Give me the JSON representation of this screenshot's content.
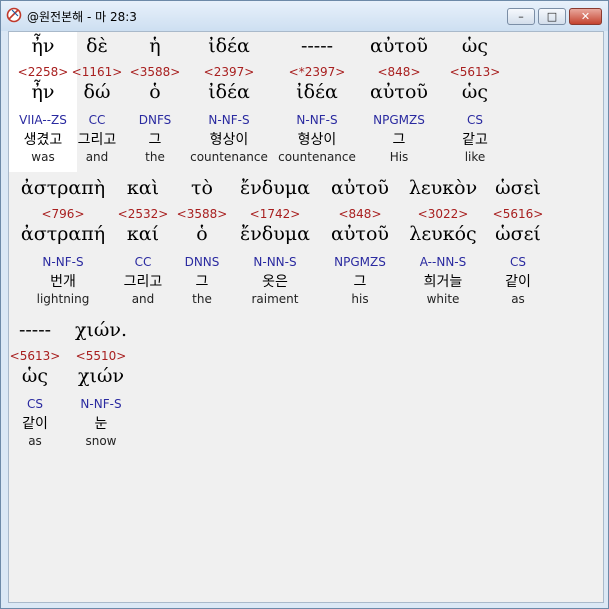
{
  "window": {
    "title": "@원전본해 - 마 28:3",
    "controls": {
      "minimize_icon": "minimize-icon",
      "maximize_icon": "maximize-icon",
      "close_icon": "close-icon"
    }
  },
  "rows": [
    [
      {
        "greek": "ἦν",
        "strong": "<2258>",
        "lemma": "ἦν",
        "parse": "VIIA--ZS",
        "korean": "생겼고",
        "english": "was"
      },
      {
        "greek": "δὲ",
        "strong": "<1161>",
        "lemma": "δώ",
        "parse": "CC",
        "korean": "그리고",
        "english": "and"
      },
      {
        "greek": "ἡ",
        "strong": "<3588>",
        "lemma": "ὁ",
        "parse": "DNFS",
        "korean": "그",
        "english": "the"
      },
      {
        "greek": "ἰδέα",
        "strong": "<2397>",
        "lemma": "ἰδέα",
        "parse": "N-NF-S",
        "korean": "형상이",
        "english": "countenance"
      },
      {
        "greek": "-----",
        "strong": "<*2397>",
        "lemma": "ἰδέα",
        "parse": "N-NF-S",
        "korean": "형상이",
        "english": "countenance"
      },
      {
        "greek": "αὐτοῦ",
        "strong": "<848>",
        "lemma": "αὐτοῦ",
        "parse": "NPGMZS",
        "korean": "그",
        "english": "His"
      },
      {
        "greek": "ὡς",
        "strong": "<5613>",
        "lemma": "ὡς",
        "parse": "CS",
        "korean": "같고",
        "english": "like"
      }
    ],
    [
      {
        "greek": "ἀστραπὴ",
        "strong": "<796>",
        "lemma": "ἀστραπή",
        "parse": "N-NF-S",
        "korean": "번개",
        "english": "lightning"
      },
      {
        "greek": "καὶ",
        "strong": "<2532>",
        "lemma": "καί",
        "parse": "CC",
        "korean": "그리고",
        "english": "and"
      },
      {
        "greek": "τὸ",
        "strong": "<3588>",
        "lemma": "ὁ",
        "parse": "DNNS",
        "korean": "그",
        "english": "the"
      },
      {
        "greek": "ἔνδυμα",
        "strong": "<1742>",
        "lemma": "ἔνδυμα",
        "parse": "N-NN-S",
        "korean": "옷은",
        "english": "raiment"
      },
      {
        "greek": "αὐτοῦ",
        "strong": "<848>",
        "lemma": "αὐτοῦ",
        "parse": "NPGMZS",
        "korean": "그",
        "english": "his"
      },
      {
        "greek": "λευκὸν",
        "strong": "<3022>",
        "lemma": "λευκός",
        "parse": "A--NN-S",
        "korean": "희거늘",
        "english": "white"
      },
      {
        "greek": "ὡσεὶ",
        "strong": "<5616>",
        "lemma": "ὡσεί",
        "parse": "CS",
        "korean": "같이",
        "english": "as"
      }
    ],
    [
      {
        "greek": "-----",
        "strong": "<5613>",
        "lemma": "ὡς",
        "parse": "CS",
        "korean": "같이",
        "english": "as"
      },
      {
        "greek": "χιών.",
        "strong": "<5510>",
        "lemma": "χιών",
        "parse": "N-NF-S",
        "korean": "눈",
        "english": "snow"
      }
    ]
  ]
}
